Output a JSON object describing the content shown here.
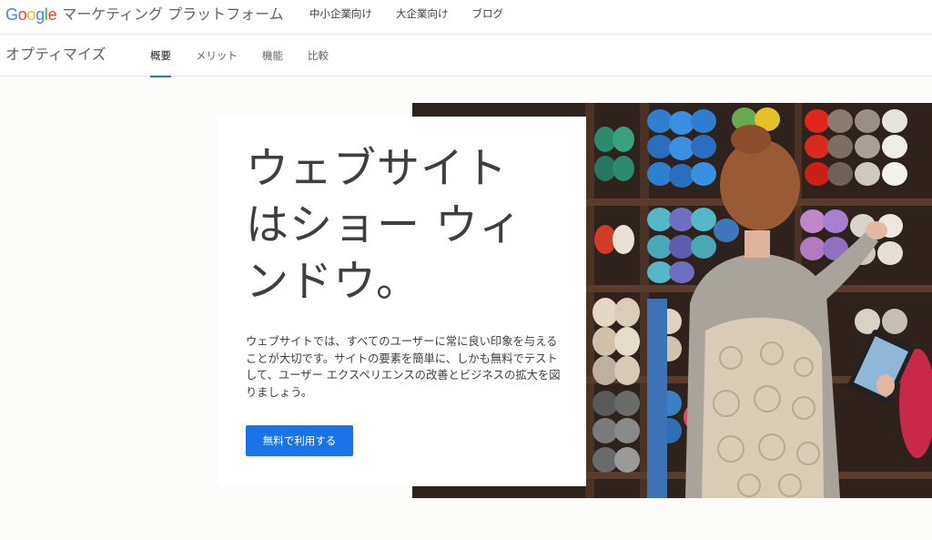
{
  "header": {
    "logo_text": "Google",
    "product_name": "マーケティング プラットフォーム",
    "nav": [
      {
        "label": "中小企業向け"
      },
      {
        "label": "大企業向け"
      },
      {
        "label": "ブログ"
      }
    ]
  },
  "subheader": {
    "title": "オプティマイズ",
    "tabs": [
      {
        "label": "概要",
        "active": true
      },
      {
        "label": "メリット",
        "active": false
      },
      {
        "label": "機能",
        "active": false
      },
      {
        "label": "比較",
        "active": false
      }
    ]
  },
  "hero": {
    "title": "ウェブサイト はショー ウィ ンドウ。",
    "description": "ウェブサイトでは、すべてのユーザーに常に良い印象を与えることが大切です。サイトの要素を簡単に、しかも無料でテストして、ユーザー エクスペリエンスの改善とビジネスの拡大を図りましょう。",
    "cta_label": "無料で利用する",
    "image_icon": "yarn-shop-photo"
  },
  "colors": {
    "accent": "#1a73e8",
    "text": "#3c4043",
    "background": "#fcfcfa"
  }
}
